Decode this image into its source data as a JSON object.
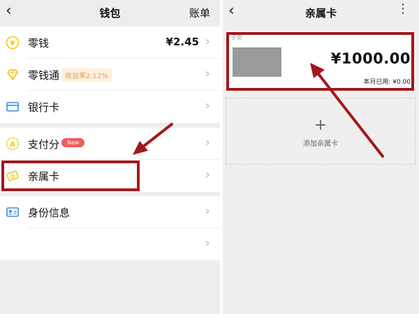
{
  "wallet": {
    "back_glyph": "‹",
    "title": "钱包",
    "bill_label": "账单",
    "items": [
      {
        "label": "零钱",
        "value": "¥2.45",
        "icon": "coin-icon",
        "color": "#f5c518"
      },
      {
        "label": "零钱通",
        "badge": "收益率2.12%",
        "icon": "diamond-icon",
        "color": "#f5c518"
      },
      {
        "label": "银行卡",
        "icon": "bank-card-icon",
        "color": "#3a8ee6"
      },
      {
        "label": "支付分",
        "badge": "New",
        "icon": "payscore-icon",
        "color": "#f5c518"
      },
      {
        "label": "亲属卡",
        "icon": "family-card-icon",
        "color": "#f5c518"
      },
      {
        "label": "身份信息",
        "icon": "id-card-icon",
        "color": "#3a8ee6"
      },
      {
        "label": "",
        "icon": "",
        "color": "#ffffff"
      }
    ],
    "chevron": "›"
  },
  "family_card": {
    "back_glyph": "‹",
    "title": "亲属卡",
    "more_glyph": "⋮",
    "card": {
      "holder_label": "子女",
      "amount": "¥1000.00",
      "used_label": "本月已用: ¥0.00"
    },
    "add_plus": "+",
    "add_label": "添加亲属卡"
  },
  "annotations": {
    "color": "#a3181c"
  }
}
